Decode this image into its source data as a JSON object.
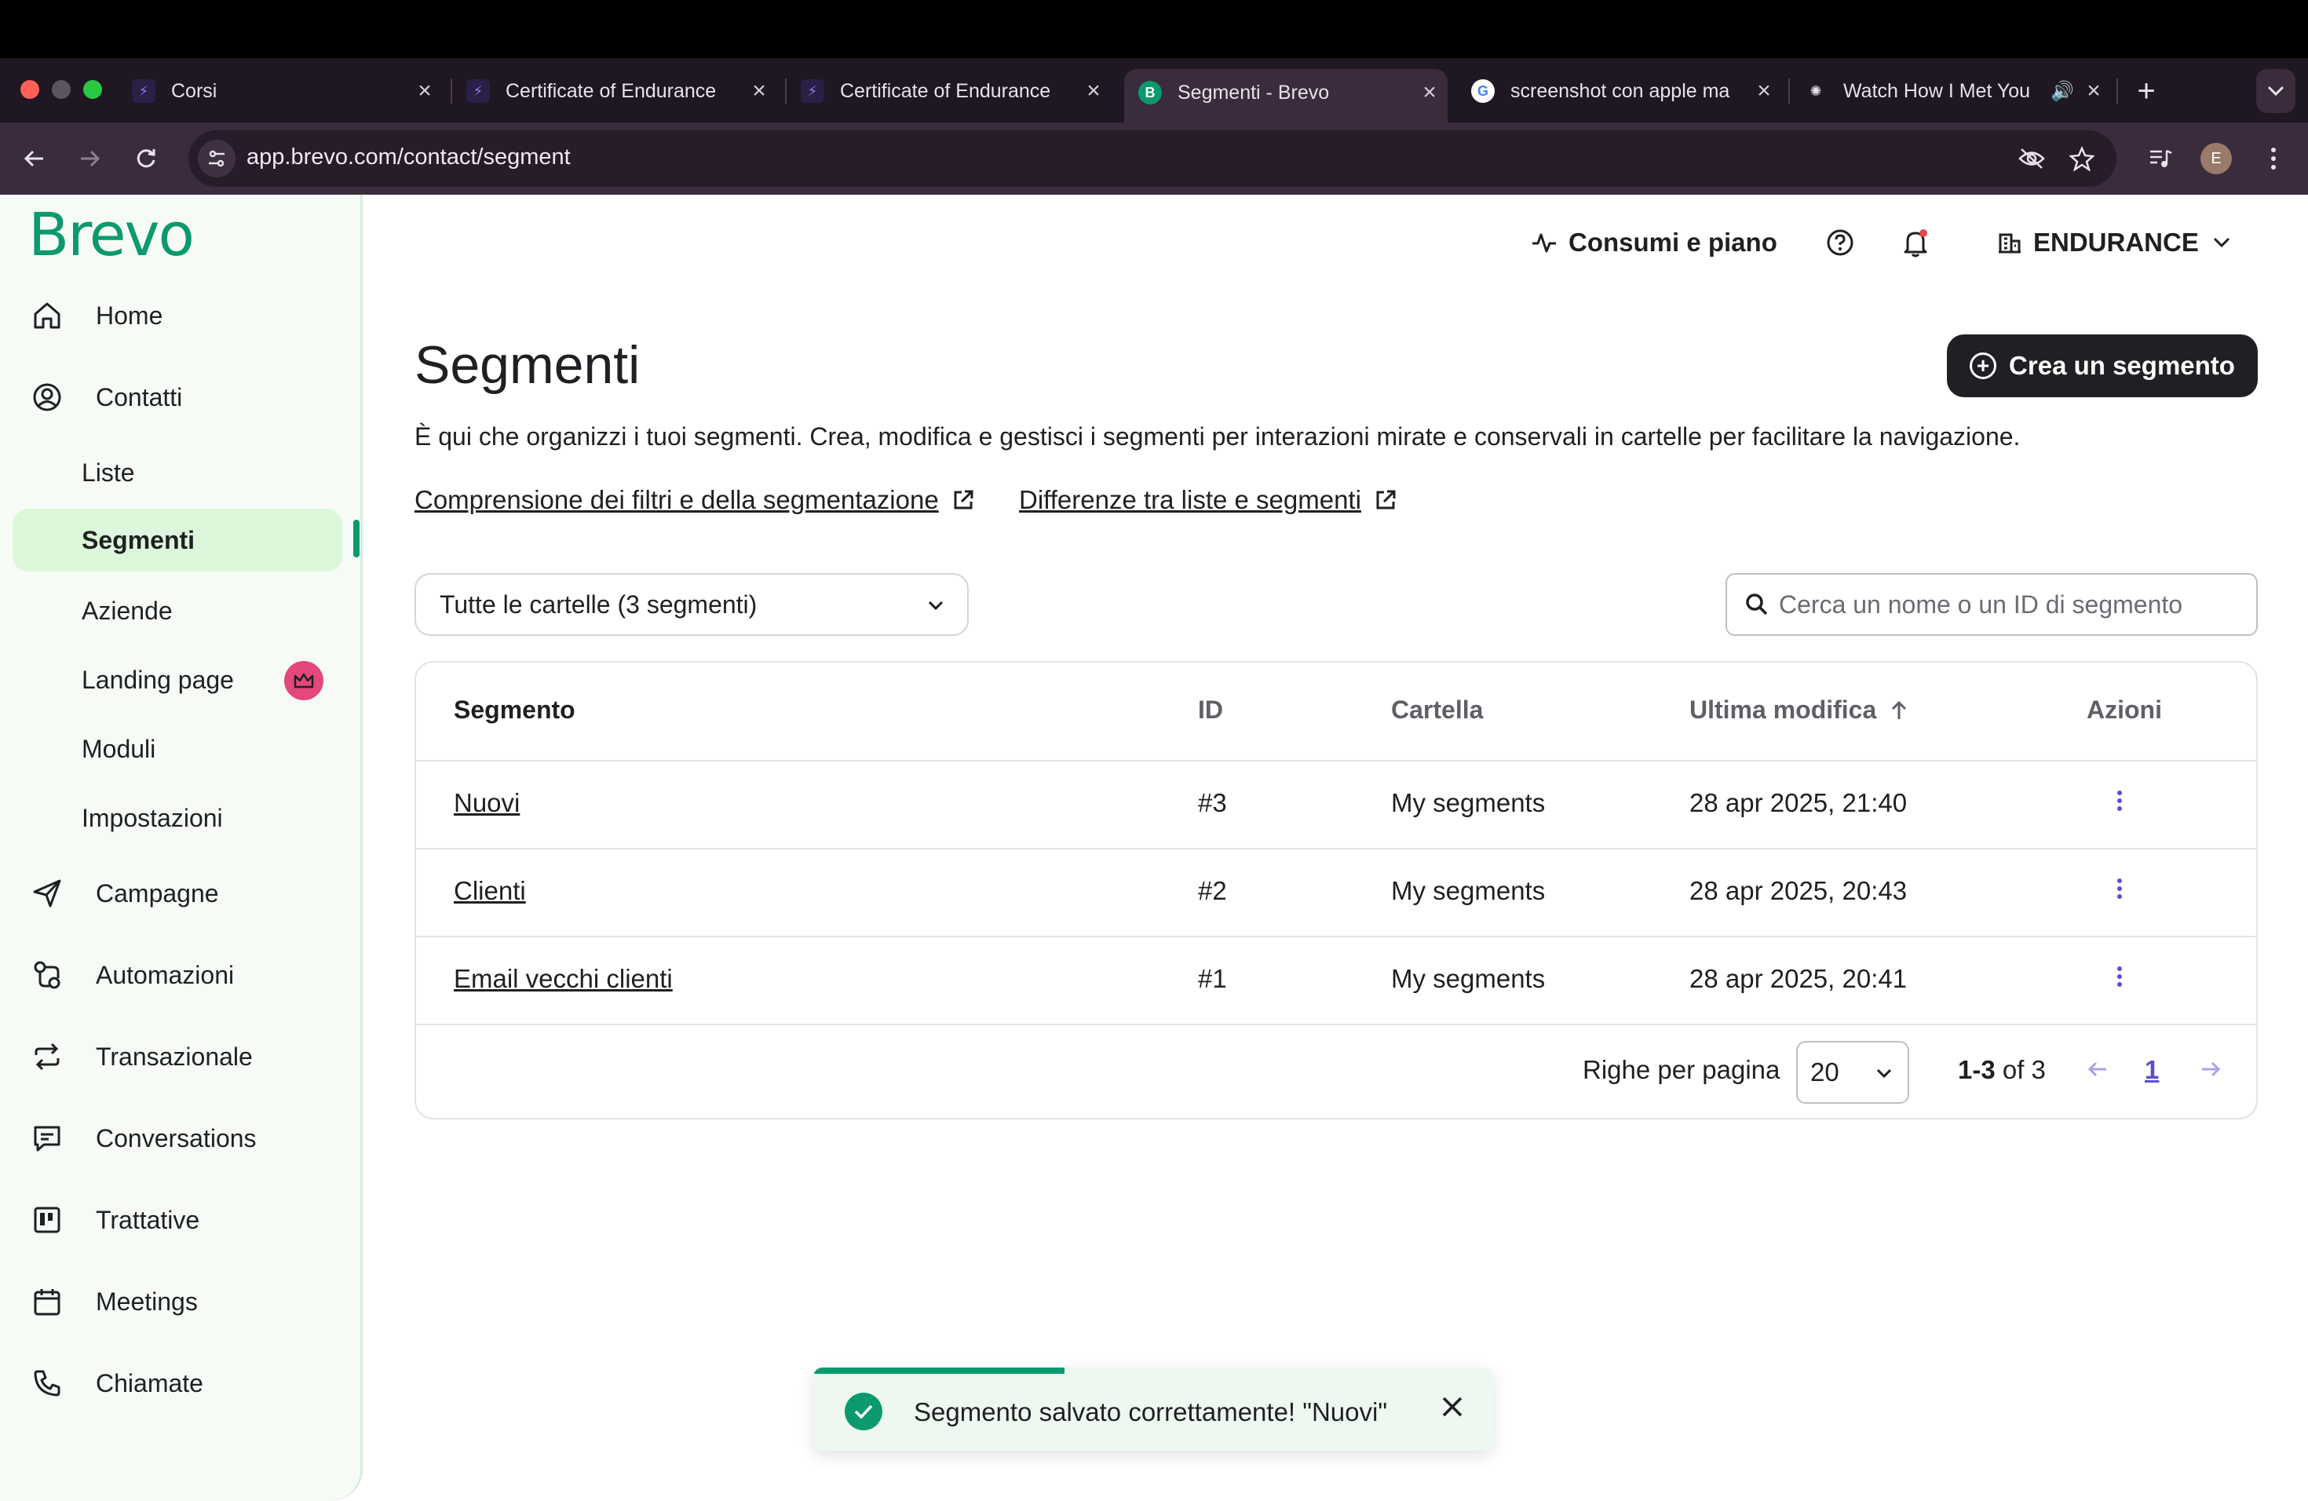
{
  "browser": {
    "tabs": [
      {
        "title": "Corsi",
        "favicon": "C"
      },
      {
        "title": "Certificate of Endurance",
        "favicon": "C"
      },
      {
        "title": "Certificate of Endurance",
        "favicon": "C"
      },
      {
        "title": "Segmenti - Brevo",
        "favicon": "B",
        "active": true
      },
      {
        "title": "screenshot con apple ma",
        "favicon": "G"
      },
      {
        "title": "Watch How I Met You",
        "favicon": "S"
      }
    ],
    "url": "app.brevo.com/contact/segment",
    "profile_initial": "E"
  },
  "sidebar": {
    "logo": "Brevo",
    "items": [
      {
        "label": "Home",
        "icon": "home-icon"
      },
      {
        "label": "Contatti",
        "icon": "user-circle-icon"
      },
      {
        "label": "Liste"
      },
      {
        "label": "Segmenti",
        "active": true
      },
      {
        "label": "Aziende"
      },
      {
        "label": "Landing page",
        "badge": "crown-icon"
      },
      {
        "label": "Moduli"
      },
      {
        "label": "Impostazioni"
      },
      {
        "label": "Campagne",
        "icon": "send-icon"
      },
      {
        "label": "Automazioni",
        "icon": "automation-icon"
      },
      {
        "label": "Transazionale",
        "icon": "repeat-icon"
      },
      {
        "label": "Conversations",
        "icon": "chat-icon"
      },
      {
        "label": "Trattative",
        "icon": "kanban-icon"
      },
      {
        "label": "Meetings",
        "icon": "calendar-icon"
      },
      {
        "label": "Chiamate",
        "icon": "phone-icon"
      }
    ]
  },
  "header": {
    "usage_label": "Consumi e piano",
    "account_label": "ENDURANCE"
  },
  "main": {
    "title": "Segmenti",
    "create_button": "Crea un segmento",
    "description": "È qui che organizzi i tuoi segmenti. Crea, modifica e gestisci i segmenti per interazioni mirate e conservali in cartelle per facilitare la navigazione.",
    "links": [
      "Comprensione dei filtri e della segmentazione",
      "Differenze tra liste e segmenti"
    ],
    "folder_filter": "Tutte le cartelle (3 segmenti)",
    "search_placeholder": "Cerca un nome o un ID di segmento"
  },
  "table": {
    "columns": [
      "Segmento",
      "ID",
      "Cartella",
      "Ultima modifica",
      "Azioni"
    ],
    "rows": [
      {
        "name": "Nuovi",
        "id": "#3",
        "folder": "My segments",
        "modified": "28 apr 2025, 21:40"
      },
      {
        "name": "Clienti",
        "id": "#2",
        "folder": "My segments",
        "modified": "28 apr 2025, 20:43"
      },
      {
        "name": "Email vecchi clienti",
        "id": "#1",
        "folder": "My segments",
        "modified": "28 apr 2025, 20:41"
      }
    ],
    "rows_per_page_label": "Righe per pagina",
    "rows_per_page": "20",
    "range_bold": "1-3",
    "range_rest": " of 3",
    "current_page": "1"
  },
  "toast": {
    "message": "Segmento salvato correttamente! \"Nuovi\"",
    "progress": 0.37
  },
  "colors": {
    "brand_green": "#0b996e",
    "active_nav_bg": "#dcf7da",
    "dark_button": "#1f2023",
    "link_purple": "#5a4fcf"
  }
}
